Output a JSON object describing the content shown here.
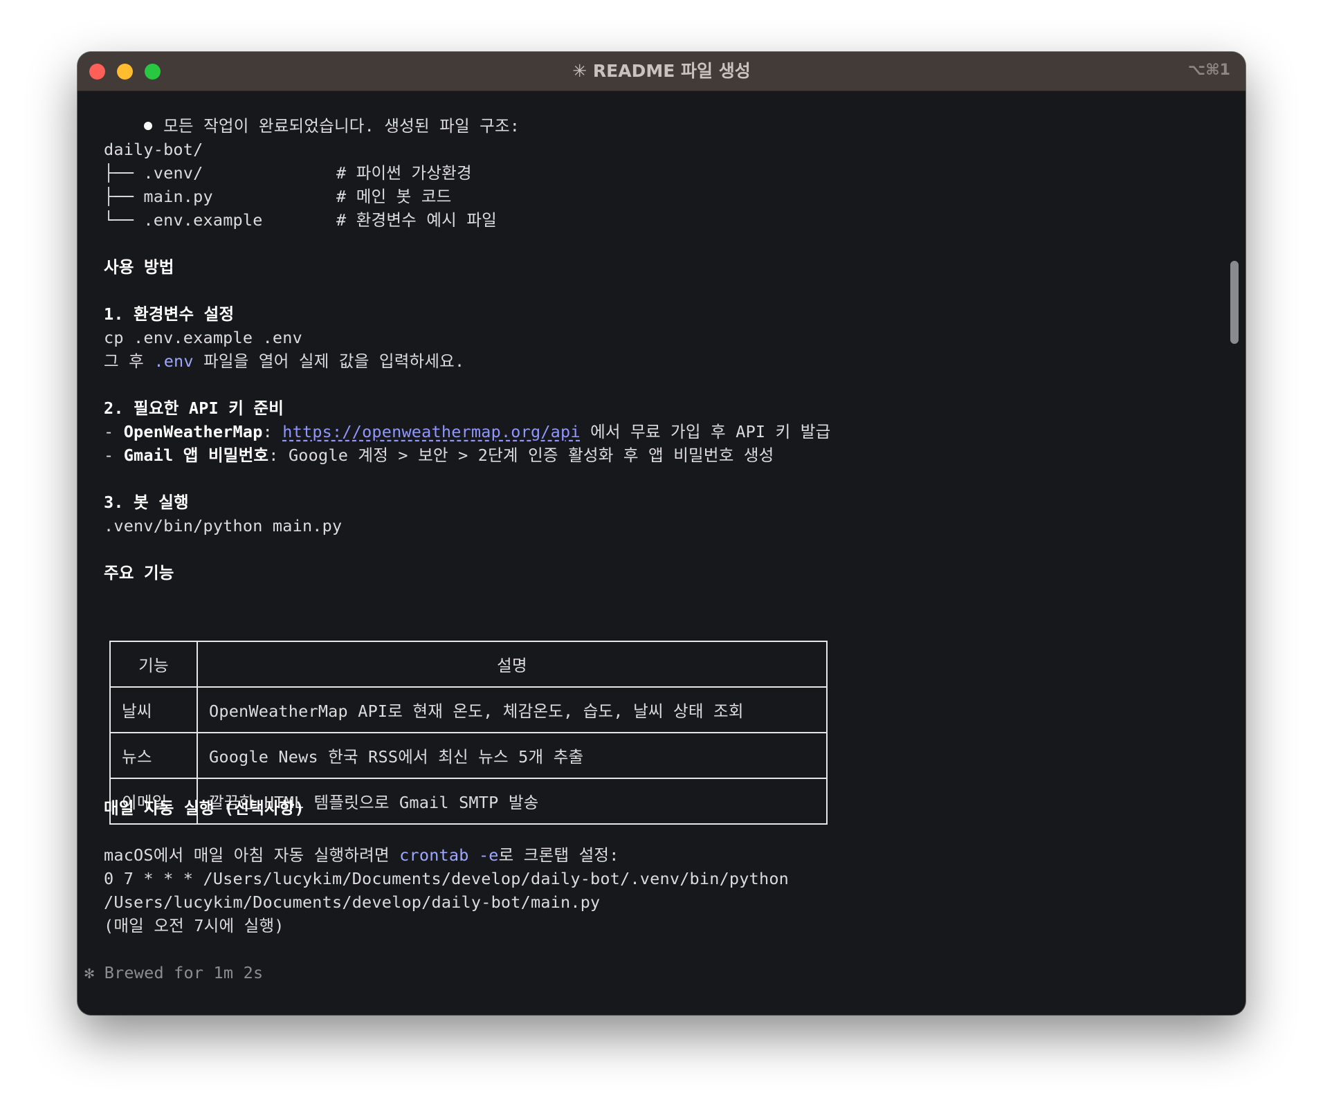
{
  "window": {
    "title": "✳ README 파일 생성",
    "shortcut": "⌥⌘1"
  },
  "summary": {
    "intro": "모든 작업이 완료되었습니다. 생성된 파일 구조:",
    "tree": [
      {
        "text": "daily-bot/"
      },
      {
        "prefix": "├── ",
        "name": ".venv/",
        "comment": "# 파이썬 가상환경"
      },
      {
        "prefix": "├── ",
        "name": "main.py",
        "comment": "# 메인 봇 코드"
      },
      {
        "prefix": "└── ",
        "name": ".env.example",
        "comment": "# 환경변수 예시 파일"
      }
    ],
    "usage_heading": "사용 방법",
    "step1_heading": "1. 환경변수 설정",
    "step1_cmd": "cp .env.example .env",
    "step1_note_before": "그 후 ",
    "step1_note_code": ".env",
    "step1_note_after": " 파일을 열어 실제 값을 입력하세요.",
    "step2_heading": "2. 필요한 API 키 준비",
    "step2_items": [
      {
        "dash": "- ",
        "label": "OpenWeatherMap",
        "sep": ": ",
        "link": "https://openweathermap.org/api",
        "rest": " 에서 무료 가입 후 API 키 발급"
      },
      {
        "dash": "- ",
        "label": "Gmail 앱 비밀번호",
        "sep": ": ",
        "rest": "Google 계정 > 보안 > 2단계 인증 활성화 후 앱 비밀번호 생성"
      }
    ],
    "step3_heading": "3. 봇 실행",
    "step3_cmd": ".venv/bin/python main.py",
    "features_heading": "주요 기능",
    "features_table": {
      "headers": [
        "기능",
        "설명"
      ],
      "rows": [
        [
          "날씨",
          "OpenWeatherMap API로 현재 온도, 체감온도, 습도, 날씨 상태 조회"
        ],
        [
          "뉴스",
          "Google News 한국 RSS에서 최신 뉴스 5개 추출"
        ],
        [
          "이메일",
          "깔끔한 HTML 템플릿으로 Gmail SMTP 발송"
        ]
      ]
    },
    "daily_heading": "매일 자동 실행 (선택사항)",
    "daily_note_before": "macOS에서 매일 아침 자동 실행하려면 ",
    "daily_note_code": "crontab -e",
    "daily_note_after": "로 크론탭 설정:",
    "cron_line1": "0 7 * * * /Users/lucykim/Documents/develop/daily-bot/.venv/bin/python",
    "cron_line2": "/Users/lucykim/Documents/develop/daily-bot/main.py",
    "cron_note": "(매일 오전 7시에 실행)"
  },
  "status": {
    "star": "✻",
    "text": "Brewed for 1m 2s"
  },
  "colors": {
    "terminal_bg": "#17181c",
    "titlebar_bg": "#433b38",
    "accent": "#9ea7ff",
    "close": "#fe5f57",
    "minimize": "#febc2e",
    "zoom": "#28c840"
  }
}
